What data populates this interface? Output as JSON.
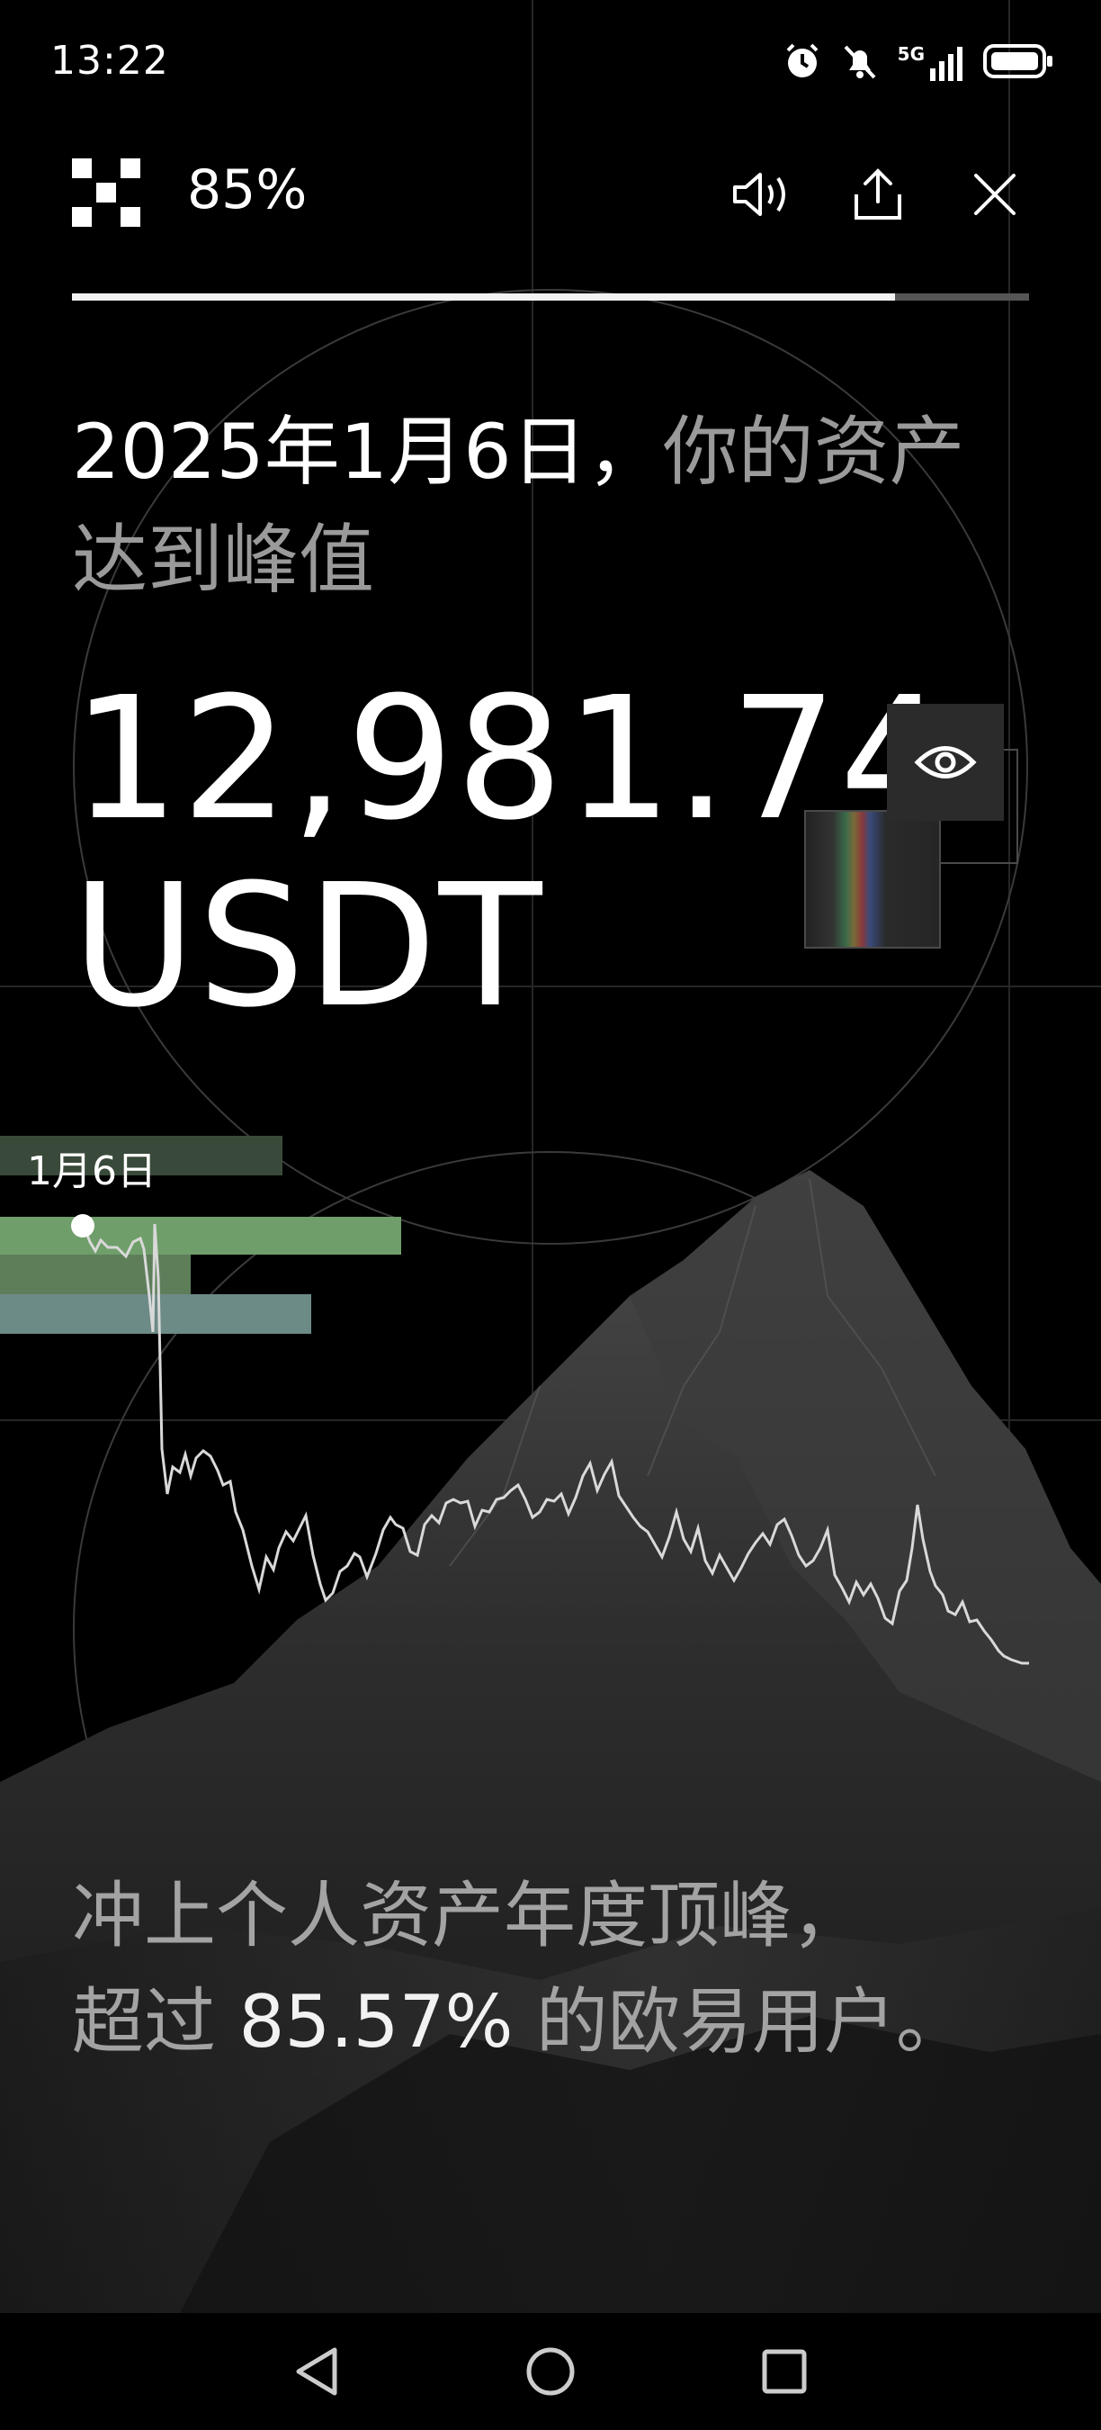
{
  "status_bar": {
    "time": "13:22",
    "network": "5G",
    "icons": [
      "alarm-icon",
      "mute-icon",
      "signal-icon",
      "battery-icon"
    ]
  },
  "header": {
    "logo": "okx-logo",
    "progress_label": "85%",
    "progress_value": 0.86,
    "buttons": [
      "sound-icon",
      "share-icon",
      "close-icon"
    ]
  },
  "headline": {
    "date": "2025年1月6日，",
    "text_1": "你的资产",
    "text_2": "达到峰值"
  },
  "amount": {
    "value": "12,981.74",
    "unit": "USDT"
  },
  "chart": {
    "date_label": "1月6日"
  },
  "summary": {
    "line_1": "冲上个人资产年度顶峰，",
    "prefix": "超过 ",
    "percent": "85.57%",
    "suffix": " 的欧易用户。"
  },
  "colors": {
    "background": "#000000",
    "text_primary": "#ffffff",
    "text_muted": "#9a9a9a",
    "highlight_green": "#6f9e6a"
  },
  "navbar": [
    "back-icon",
    "home-icon",
    "recents-icon"
  ]
}
